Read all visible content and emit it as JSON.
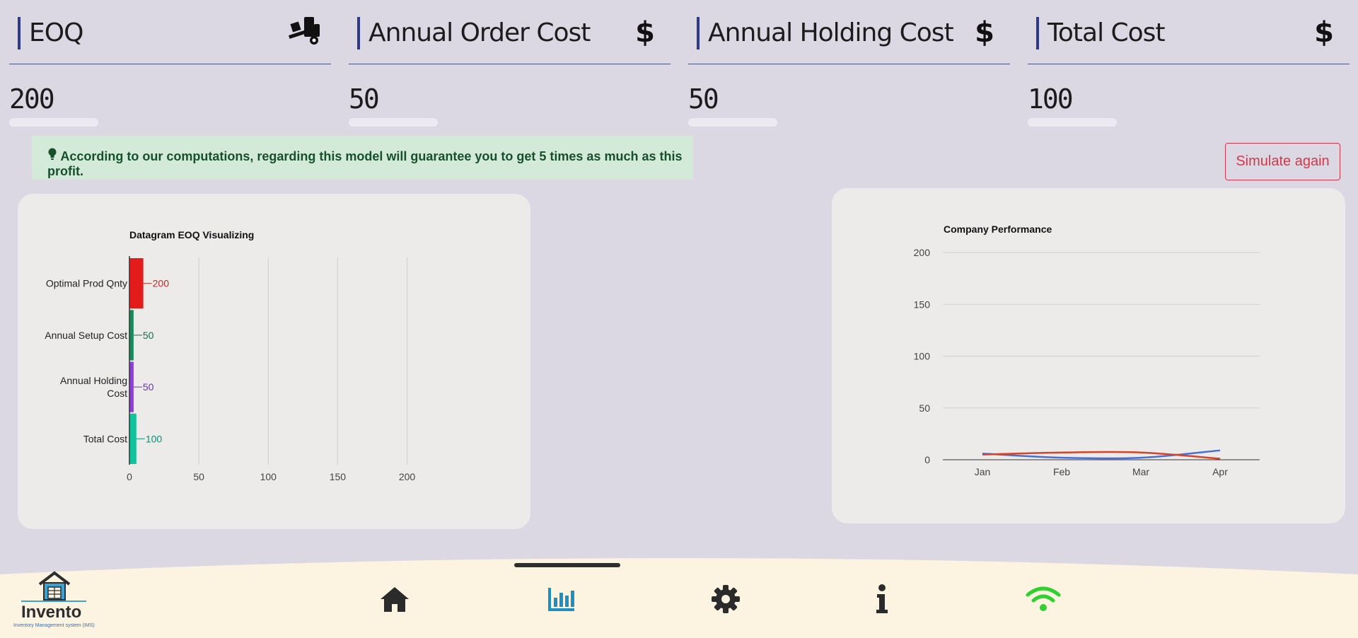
{
  "kpis": [
    {
      "title": "EOQ",
      "value": "200",
      "icon": "truck-loading-icon"
    },
    {
      "title": "Annual Order Cost",
      "value": "50",
      "icon": "dollar-icon"
    },
    {
      "title": "Annual Holding Cost",
      "value": "50",
      "icon": "dollar-icon"
    },
    {
      "title": "Total Cost",
      "value": "100",
      "icon": "dollar-icon"
    }
  ],
  "icons": {
    "dollar": "$"
  },
  "alert": {
    "icon": "lightbulb-icon",
    "text": "According to our computations, regarding this model will guarantee you to get 5 times as much as this profit."
  },
  "simulate_button": "Simulate again",
  "chart_data": [
    {
      "type": "bar",
      "orientation": "horizontal",
      "title": "Datagram EOQ Visualizing",
      "categories": [
        "Optimal Prod Qnty",
        "Annual Setup Cost",
        "Annual Holding Cost",
        "Total Cost"
      ],
      "values": [
        200,
        50,
        50,
        100
      ],
      "bar_lengths": [
        10,
        3,
        3,
        5
      ],
      "colors": [
        "#e31b1b",
        "#1a8a5c",
        "#8a3fd6",
        "#12c29a"
      ],
      "label_colors": [
        "#b5312a",
        "#1a6a4a",
        "#6a34b3",
        "#138a73"
      ],
      "xticks": [
        "0",
        "50",
        "100",
        "150",
        "200"
      ],
      "xlim": [
        0,
        240
      ],
      "grid": true
    },
    {
      "type": "line",
      "title": "Company Performance",
      "categories": [
        "Jan",
        "Feb",
        "Mar",
        "Apr"
      ],
      "series": [
        {
          "color": "#4a6fd1",
          "values": [
            6,
            2,
            2,
            9
          ]
        },
        {
          "color": "#d2452a",
          "values": [
            5,
            7,
            7,
            1
          ]
        }
      ],
      "yticks": [
        "0",
        "50",
        "100",
        "150",
        "200"
      ],
      "ylim": [
        0,
        200
      ],
      "grid": true
    }
  ],
  "nav": [
    {
      "name": "home-icon",
      "color": "#2b2b2b",
      "active": false
    },
    {
      "name": "chart-bar-icon",
      "color": "#1e8fc4",
      "active": true
    },
    {
      "name": "gear-icon",
      "color": "#2b2b2b",
      "active": false
    },
    {
      "name": "info-icon",
      "color": "#2b2b2b",
      "active": false
    },
    {
      "name": "wifi-icon",
      "color": "#2ed12e",
      "active": false
    }
  ],
  "logo": {
    "brand": "Invento",
    "tagline": "Inventory Management system (IMS)"
  }
}
